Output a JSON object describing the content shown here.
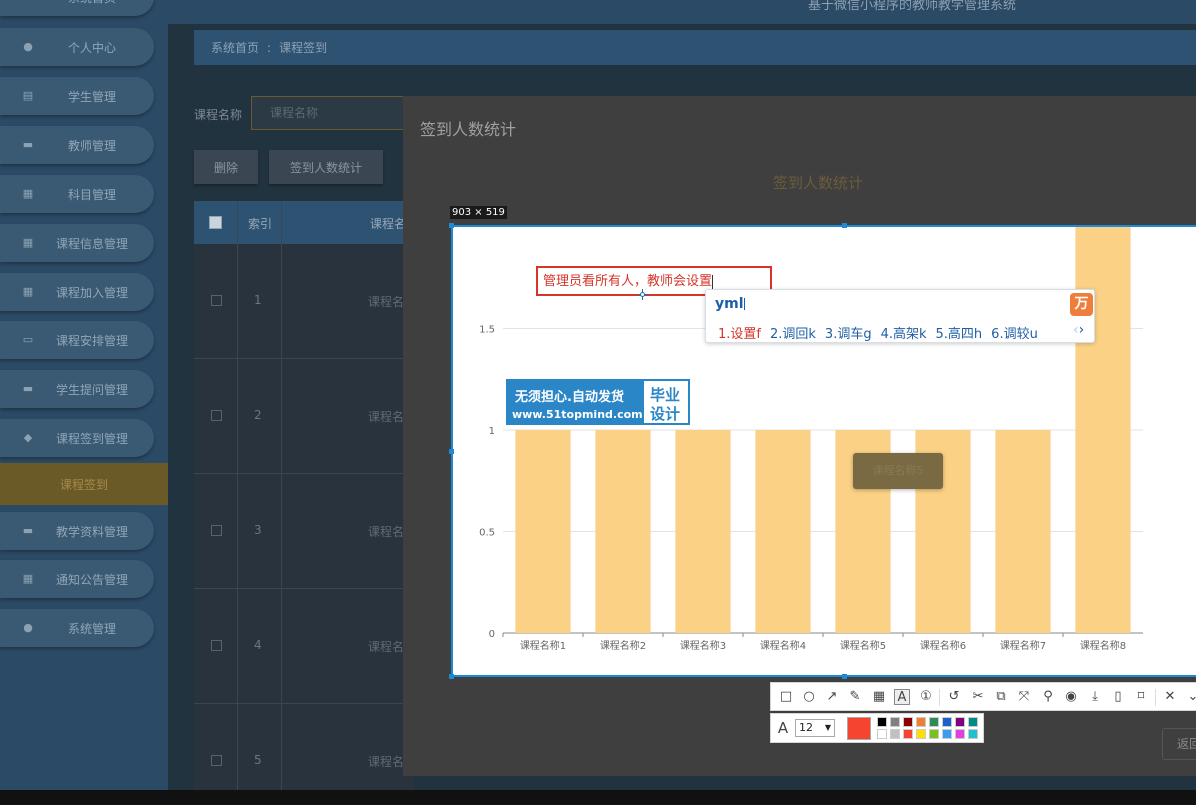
{
  "app": {
    "header_title": "基于微信小程序的教师教学管理系统"
  },
  "sidebar": {
    "items": [
      {
        "label": "系统首页",
        "icon": "home-icon"
      },
      {
        "label": "个人中心",
        "icon": "person-icon"
      },
      {
        "label": "学生管理",
        "icon": "clipboard-icon"
      },
      {
        "label": "教师管理",
        "icon": "monitor-icon"
      },
      {
        "label": "科目管理",
        "icon": "grid-icon"
      },
      {
        "label": "课程信息管理",
        "icon": "grid-icon"
      },
      {
        "label": "课程加入管理",
        "icon": "grid-icon"
      },
      {
        "label": "课程安排管理",
        "icon": "briefcase-icon"
      },
      {
        "label": "学生提问管理",
        "icon": "monitor-icon"
      },
      {
        "label": "课程签到管理",
        "icon": "pin-icon"
      },
      {
        "label": "教学资料管理",
        "icon": "chat-icon"
      },
      {
        "label": "通知公告管理",
        "icon": "grid-icon"
      },
      {
        "label": "系统管理",
        "icon": "person-icon"
      }
    ],
    "active_sub": "课程签到"
  },
  "breadcrumb": {
    "home": "系统首页",
    "sep": ":",
    "current": "课程签到"
  },
  "search": {
    "label": "课程名称",
    "placeholder": "课程名称"
  },
  "buttons": {
    "delete": "删除",
    "stats": "签到人数统计"
  },
  "table": {
    "headers": {
      "index": "索引",
      "name": "课程名"
    },
    "rows": [
      {
        "index": "1",
        "name": "课程名"
      },
      {
        "index": "2",
        "name": "课程名"
      },
      {
        "index": "3",
        "name": "课程名"
      },
      {
        "index": "4",
        "name": "课程名"
      },
      {
        "index": "5",
        "name": "课程名"
      }
    ]
  },
  "dialog": {
    "title": "签到人数统计",
    "chart_title": "签到人数统计",
    "back_button": "返回"
  },
  "selection": {
    "size_label": "903 × 519"
  },
  "annotation": {
    "text": "管理员看所有人，教师会设置"
  },
  "ime": {
    "pinyin": "yml",
    "logo": "万",
    "candidates": [
      "1.设置f",
      "2.调回k",
      "3.调车g",
      "4.高架k",
      "5.高四h",
      "6.调较u"
    ]
  },
  "watermark": {
    "line1": "无须担心.自动发货",
    "line2": "www.51topmind.com",
    "right1": "毕业",
    "right2": "设计"
  },
  "tooltip": {
    "text": "课程名称5"
  },
  "toolbar": {
    "font_size": "12",
    "current_color": "#f5452f"
  },
  "chart_data": {
    "type": "bar",
    "categories": [
      "课程名称1",
      "课程名称2",
      "课程名称3",
      "课程名称4",
      "课程名称5",
      "课程名称6",
      "课程名称7",
      "课程名称8"
    ],
    "values": [
      1,
      1,
      1,
      1,
      1,
      1,
      1,
      2
    ],
    "yticks": [
      "0",
      "0.5",
      "1",
      "1.5"
    ],
    "ylim": [
      0,
      2
    ],
    "color": "#fbd185"
  }
}
